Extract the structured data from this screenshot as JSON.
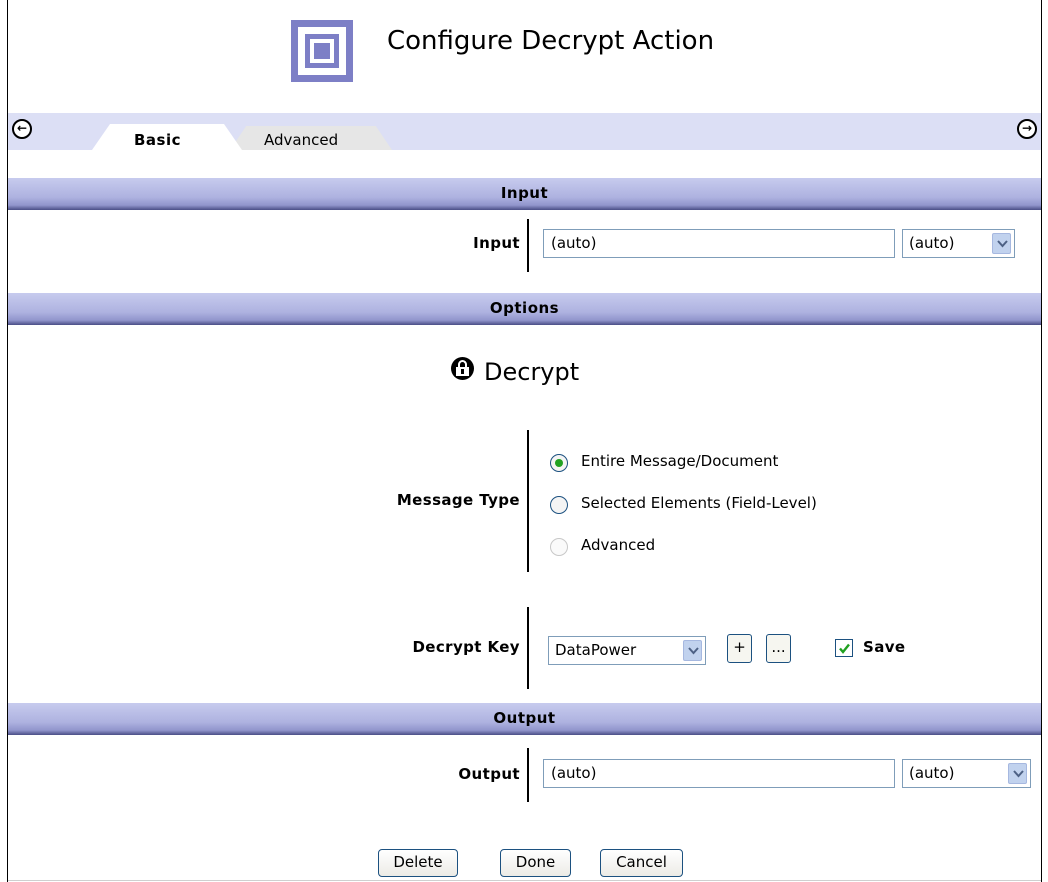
{
  "header": {
    "title": "Configure Decrypt Action",
    "icon": "action-square-icon",
    "accent_color": "#7d7fc6"
  },
  "tabs": {
    "items": [
      {
        "label": "Basic",
        "active": true
      },
      {
        "label": "Advanced",
        "active": false
      }
    ],
    "left_arrow": "←",
    "right_arrow": "→",
    "strip_color": "#dcdff5"
  },
  "sections": {
    "input": "Input",
    "options": "Options",
    "output": "Output"
  },
  "input_row": {
    "label": "Input",
    "value": "(auto)",
    "select_value": "(auto)"
  },
  "options": {
    "heading": "Decrypt",
    "message_type": {
      "label": "Message Type",
      "choices": [
        {
          "label": "Entire Message/Document",
          "selected": true,
          "enabled": true
        },
        {
          "label": "Selected Elements (Field-Level)",
          "selected": false,
          "enabled": true
        },
        {
          "label": "Advanced",
          "selected": false,
          "enabled": false
        }
      ]
    },
    "decrypt_key": {
      "label": "Decrypt Key",
      "select_value": "DataPower",
      "add_label": "+",
      "edit_label": "...",
      "save_label": "Save",
      "save_checked": true
    }
  },
  "output_row": {
    "label": "Output",
    "value": "(auto)",
    "select_value": "(auto)"
  },
  "footer": {
    "delete_label": "Delete",
    "done_label": "Done",
    "cancel_label": "Cancel"
  }
}
